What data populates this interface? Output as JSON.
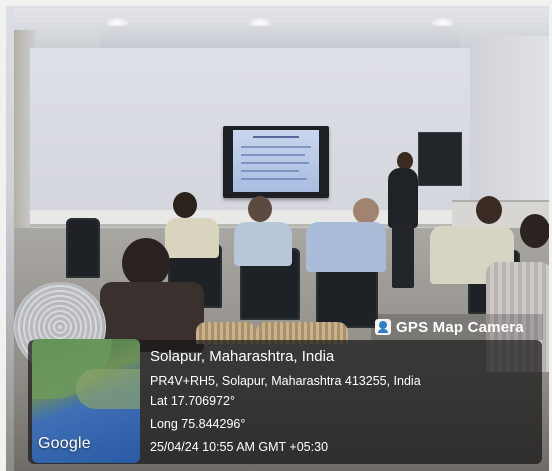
{
  "overlay": {
    "app_name": "GPS Map Camera",
    "location_title": "Solapur, Maharashtra, India",
    "address": "PR4V+RH5, Solapur, Maharashtra 413255, India",
    "latitude": "Lat 17.706972°",
    "longitude": "Long 75.844296°",
    "datetime": "25/04/24 10:55 AM GMT +05:30",
    "map_attribution": "Google",
    "icons": [
      "gps-camera-icon"
    ]
  },
  "scene": {
    "tv_screen_color": "#b7c7e6",
    "panel_color": "#161616"
  }
}
